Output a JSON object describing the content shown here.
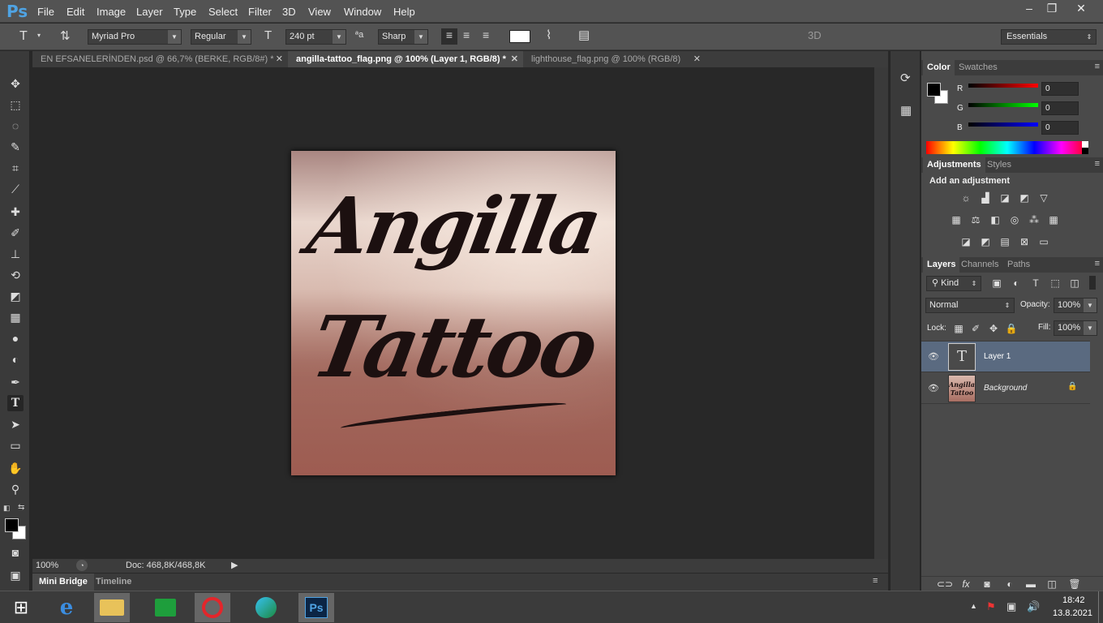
{
  "app": {
    "logo": "Ps",
    "menu": [
      "File",
      "Edit",
      "Image",
      "Layer",
      "Type",
      "Select",
      "Filter",
      "3D",
      "View",
      "Window",
      "Help"
    ]
  },
  "window_controls": {
    "minimize": "–",
    "restore": "❐",
    "close": "✕"
  },
  "options": {
    "font_family": "Myriad Pro",
    "font_style": "Regular",
    "font_size": "240 pt",
    "aa_icon": "ªa",
    "antialias": "Sharp",
    "mode_3d": "3D",
    "workspace": "Essentials"
  },
  "tabs": [
    {
      "label": "EN EFSANELERİNDEN.psd @ 66,7% (BERKE, RGB/8#) *",
      "close": "✕"
    },
    {
      "label": "angilla-tattoo_flag.png @ 100% (Layer 1, RGB/8) *",
      "close": "✕"
    },
    {
      "label": "lighthouse_flag.png @ 100% (RGB/8)",
      "close": "✕"
    }
  ],
  "artwork": {
    "line1": "Angilla",
    "line2": "Tattoo",
    "thumb_text": "Angilla Tattoo"
  },
  "status": {
    "zoom": "100%",
    "doc": "Doc: 468,8K/468,8K"
  },
  "bottom_tabs": [
    "Mini Bridge",
    "Timeline"
  ],
  "color_panel": {
    "tabs": [
      "Color",
      "Swatches"
    ],
    "channels": [
      {
        "label": "R",
        "value": "0"
      },
      {
        "label": "G",
        "value": "0"
      },
      {
        "label": "B",
        "value": "0"
      }
    ]
  },
  "adjust_panel": {
    "tabs": [
      "Adjustments",
      "Styles"
    ],
    "title": "Add an adjustment"
  },
  "layers_panel": {
    "tabs": [
      "Layers",
      "Channels",
      "Paths"
    ],
    "kind": "Kind",
    "blend": "Normal",
    "opacity_label": "Opacity:",
    "opacity": "100%",
    "lock_label": "Lock:",
    "fill_label": "Fill:",
    "fill": "100%",
    "layers": [
      {
        "name": "Layer 1",
        "type_icon": "T"
      },
      {
        "name": "Background",
        "lock_icon": "🔒"
      }
    ]
  },
  "taskbar": {
    "time": "18:42",
    "date": "13.8.2021",
    "ps_label": "Ps"
  },
  "colors": {
    "brand": "#4fa3e3",
    "panel": "#4a4a4a",
    "selected_layer": "#5a6a80"
  }
}
